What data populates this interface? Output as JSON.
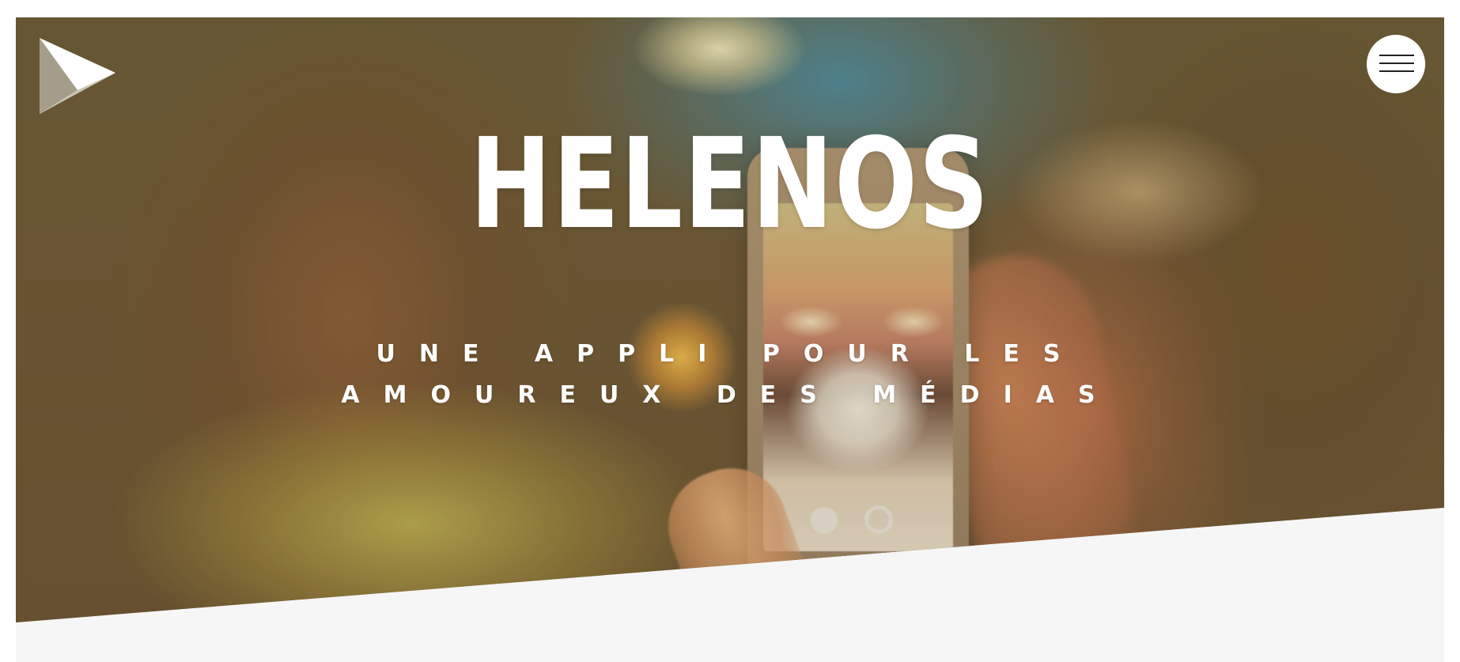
{
  "hero": {
    "brand": "HELENOS",
    "tagline_line1": "UNE APPLI POUR LES",
    "tagline_line2": "AMOUREUX DES MÉDIAS"
  },
  "header": {
    "logo_icon": "play-triangle-logo-icon",
    "menu_icon": "hamburger-menu-icon"
  },
  "colors": {
    "hero_tint": "#6a5231",
    "text": "#ffffff",
    "section_bg": "#f6f6f6",
    "menu_button_bg": "#ffffff"
  }
}
